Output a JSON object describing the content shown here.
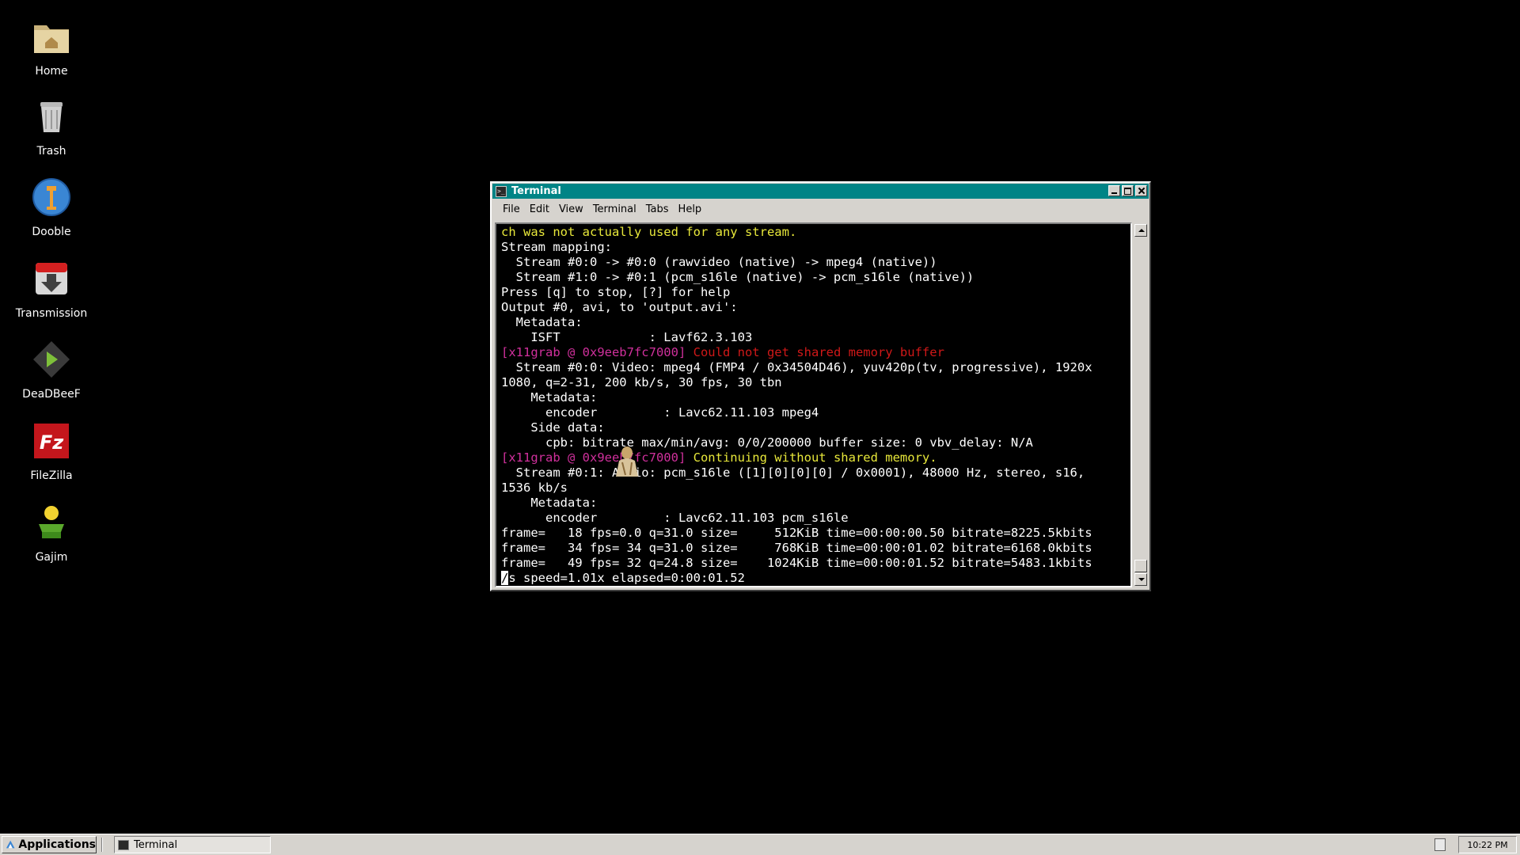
{
  "desktop": {
    "icons": [
      {
        "label": "Home",
        "icon": "home-folder-icon"
      },
      {
        "label": "Trash",
        "icon": "trash-icon"
      },
      {
        "label": "Dooble",
        "icon": "dooble-browser-icon"
      },
      {
        "label": "Transmission",
        "icon": "transmission-icon"
      },
      {
        "label": "DeaDBeeF",
        "icon": "deadbeef-player-icon"
      },
      {
        "label": "FileZilla",
        "icon": "filezilla-icon"
      },
      {
        "label": "Gajim",
        "icon": "gajim-icon"
      }
    ]
  },
  "window": {
    "title": "Terminal",
    "menu": [
      "File",
      "Edit",
      "View",
      "Terminal",
      "Tabs",
      "Help"
    ],
    "colors": {
      "titlebar": "#008486",
      "warning_yellow": "#e8e83a",
      "tag_magenta": "#d0309c",
      "error_red": "#d01818"
    }
  },
  "terminal": {
    "lines": [
      [
        {
          "t": "ch was not actually used for any stream.",
          "c": "yellow"
        }
      ],
      [
        {
          "t": "Stream mapping:",
          "c": "white"
        }
      ],
      [
        {
          "t": "  Stream #0:0 -> #0:0 (rawvideo (native) -> mpeg4 (native))",
          "c": "white"
        }
      ],
      [
        {
          "t": "  Stream #1:0 -> #0:1 (pcm_s16le (native) -> pcm_s16le (native))",
          "c": "white"
        }
      ],
      [
        {
          "t": "Press [q] to stop, [?] for help",
          "c": "white"
        }
      ],
      [
        {
          "t": "Output #0, avi, to 'output.avi':",
          "c": "white"
        }
      ],
      [
        {
          "t": "  Metadata:",
          "c": "white"
        }
      ],
      [
        {
          "t": "    ISFT            : Lavf62.3.103",
          "c": "white"
        }
      ],
      [
        {
          "t": "[x11grab @ 0x9eeb7fc7000] ",
          "c": "magenta"
        },
        {
          "t": "Could not get shared memory buffer",
          "c": "red"
        }
      ],
      [
        {
          "t": "  Stream #0:0: Video: mpeg4 (FMP4 / 0x34504D46), yuv420p(tv, progressive), 1920x",
          "c": "white"
        }
      ],
      [
        {
          "t": "1080, q=2-31, 200 kb/s, 30 fps, 30 tbn",
          "c": "white"
        }
      ],
      [
        {
          "t": "    Metadata:",
          "c": "white"
        }
      ],
      [
        {
          "t": "      encoder         : Lavc62.11.103 mpeg4",
          "c": "white"
        }
      ],
      [
        {
          "t": "    Side data:",
          "c": "white"
        }
      ],
      [
        {
          "t": "      cpb: bitrate max/min/avg: 0/0/200000 buffer size: 0 vbv_delay: N/A",
          "c": "white"
        }
      ],
      [
        {
          "t": "[x11grab @ 0x9eeb7fc7000] ",
          "c": "magenta"
        },
        {
          "t": "Continuing without shared memory.",
          "c": "yellow"
        }
      ],
      [
        {
          "t": "  Stream #0:1: Audio: pcm_s16le ([1][0][0][0] / 0x0001), 48000 Hz, stereo, s16,",
          "c": "white"
        }
      ],
      [
        {
          "t": "1536 kb/s",
          "c": "white"
        }
      ],
      [
        {
          "t": "    Metadata:",
          "c": "white"
        }
      ],
      [
        {
          "t": "      encoder         : Lavc62.11.103 pcm_s16le",
          "c": "white"
        }
      ],
      [
        {
          "t": "frame=   18 fps=0.0 q=31.0 size=     512KiB time=00:00:00.50 bitrate=8225.5kbits",
          "c": "white"
        }
      ],
      [
        {
          "t": "frame=   34 fps= 34 q=31.0 size=     768KiB time=00:00:01.02 bitrate=6168.0kbits",
          "c": "white"
        }
      ],
      [
        {
          "t": "frame=   49 fps= 32 q=24.8 size=    1024KiB time=00:00:01.52 bitrate=5483.1kbits",
          "c": "white"
        }
      ],
      [
        {
          "t": "/",
          "c": "cursor"
        },
        {
          "t": "s speed=1.01x elapsed=0:00:01.52",
          "c": "white"
        }
      ]
    ]
  },
  "taskbar": {
    "applications_label": "Applications",
    "tasks": [
      {
        "label": "Terminal",
        "icon": "terminal-icon"
      }
    ],
    "clock": "10:22 PM"
  }
}
